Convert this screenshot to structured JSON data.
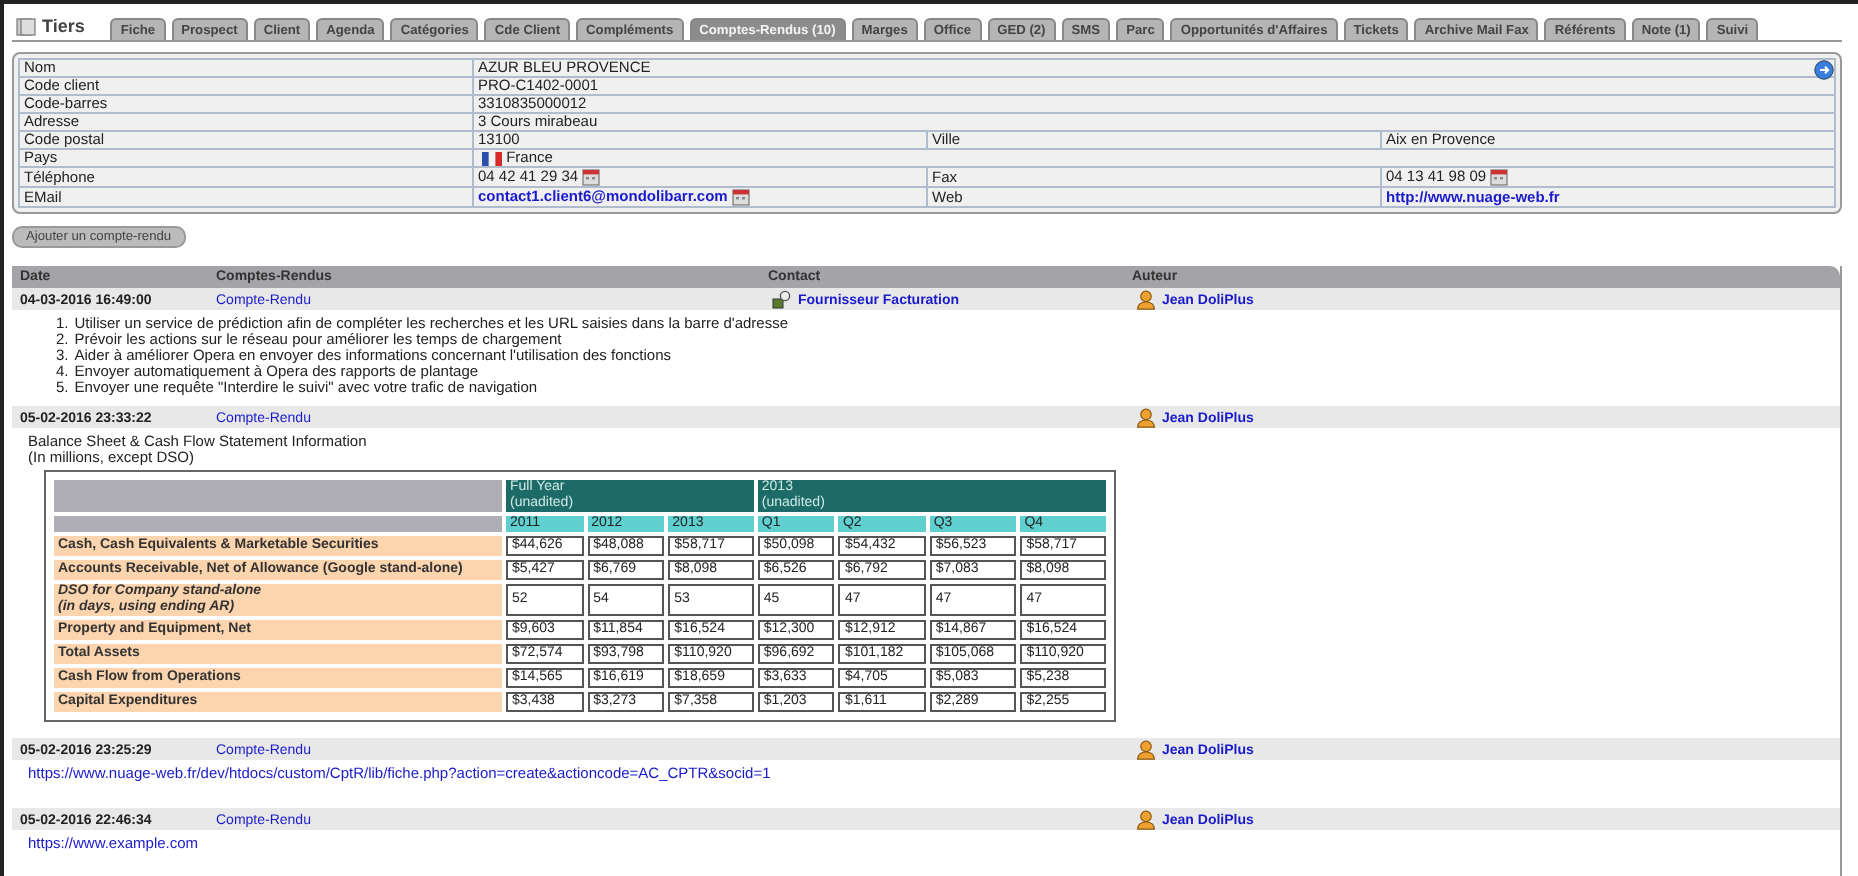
{
  "title": "Tiers",
  "tabs": [
    {
      "label": "Fiche",
      "selected": false
    },
    {
      "label": "Prospect",
      "selected": false
    },
    {
      "label": "Client",
      "selected": false
    },
    {
      "label": "Agenda",
      "selected": false
    },
    {
      "label": "Catégories",
      "selected": false
    },
    {
      "label": "Cde Client",
      "selected": false
    },
    {
      "label": "Compléments",
      "selected": false
    },
    {
      "label": "Comptes-Rendus (10)",
      "selected": true
    },
    {
      "label": "Marges",
      "selected": false
    },
    {
      "label": "Office",
      "selected": false
    },
    {
      "label": "GED (2)",
      "selected": false
    },
    {
      "label": "SMS",
      "selected": false
    },
    {
      "label": "Parc",
      "selected": false
    },
    {
      "label": "Opportunités d'Affaires",
      "selected": false
    },
    {
      "label": "Tickets",
      "selected": false
    },
    {
      "label": "Archive Mail Fax",
      "selected": false
    },
    {
      "label": "Référents",
      "selected": false
    },
    {
      "label": "Note (1)",
      "selected": false
    },
    {
      "label": "Suivi",
      "selected": false
    }
  ],
  "info": [
    {
      "cells": [
        {
          "text": "Nom"
        },
        {
          "text": "AZUR BLEU PROVENCE"
        }
      ]
    },
    {
      "cells": [
        {
          "text": "Code client"
        },
        {
          "text": "PRO-C1402-0001"
        }
      ]
    },
    {
      "cells": [
        {
          "text": "Code-barres"
        },
        {
          "text": "3310835000012"
        }
      ]
    },
    {
      "cells": [
        {
          "text": "Adresse"
        },
        {
          "text": "3 Cours mirabeau"
        }
      ]
    },
    {
      "cells": [
        {
          "text": "Code postal"
        },
        {
          "text": "13100"
        },
        {
          "text": "Ville"
        },
        {
          "text": "Aix en Provence"
        }
      ]
    },
    {
      "cells": [
        {
          "text": "Pays"
        },
        {
          "text": "France",
          "kind": "flag"
        }
      ]
    },
    {
      "cells": [
        {
          "text": "Téléphone"
        },
        {
          "text": "04 42 41 29 34",
          "kind": "calendar"
        },
        {
          "text": "Fax"
        },
        {
          "text": "04 13 41 98 09",
          "kind": "calendar"
        }
      ]
    },
    {
      "cells": [
        {
          "text": "EMail"
        },
        {
          "text": "contact1.client6@mondolibarr.com",
          "kind": "link_calendar"
        },
        {
          "text": "Web"
        },
        {
          "text": "http://www.nuage-web.fr",
          "kind": "link"
        }
      ]
    }
  ],
  "add_button": "Ajouter un compte-rendu",
  "columns": [
    "Date",
    "Comptes-Rendus",
    "Contact",
    "Auteur"
  ],
  "entries": [
    {
      "date": "04-03-2016 16:49:00",
      "title": "Compte-Rendu",
      "contact": "Fournisseur Facturation",
      "author": "Jean DoliPlus",
      "body": {
        "kind": "list",
        "items": [
          {
            "number": "1.",
            "text": "Utiliser un service de prédiction afin de compléter les recherches et les URL saisies dans la barre d'adresse"
          },
          {
            "number": "2.",
            "text": "Prévoir les actions sur le réseau pour améliorer les temps de chargement"
          },
          {
            "number": "3.",
            "text": "Aider à améliorer Opera en envoyer des informations concernant l'utilisation des fonctions"
          },
          {
            "number": "4.",
            "text": "Envoyer automatiquement à Opera des rapports de plantage"
          },
          {
            "number": "5.",
            "text": "Envoyer une requête \"Interdire le suivi\" avec votre trafic de navigation"
          }
        ]
      }
    },
    {
      "date": "05-02-2016 23:33:22",
      "title": "Compte-Rendu",
      "author": "Jean DoliPlus",
      "body": {
        "kind": "table",
        "caption": [
          "Balance Sheet & Cash Flow Statement Information",
          "(In millions, except DSO)"
        ],
        "groups": [
          {
            "lines": [
              "Full Year",
              "(unadited)"
            ]
          },
          {
            "lines": [
              "2013",
              "(unadited)"
            ]
          }
        ],
        "columns": [
          "2011",
          "2012",
          "2013",
          "Q1",
          "Q2",
          "Q3",
          "Q4"
        ],
        "rows": [
          {
            "lines": [
              "Cash, Cash Equivalents & Marketable Securities"
            ],
            "italic": false,
            "values": [
              "$44,626",
              "$48,088",
              "$58,717",
              "$50,098",
              "$54,432",
              "$56,523",
              "$58,717"
            ]
          },
          {
            "lines": [
              "Accounts Receivable, Net of Allowance (Google stand-alone)"
            ],
            "italic": false,
            "values": [
              "$5,427",
              "$6,769",
              "$8,098",
              "$6,526",
              "$6,792",
              "$7,083",
              "$8,098"
            ]
          },
          {
            "lines": [
              "DSO for Company stand-alone",
              "(in days, using ending AR)"
            ],
            "italic": true,
            "values": [
              "52",
              "54",
              "53",
              "45",
              "47",
              "47",
              "47"
            ]
          },
          {
            "lines": [
              "Property and Equipment, Net"
            ],
            "italic": false,
            "values": [
              "$9,603",
              "$11,854",
              "$16,524",
              "$12,300",
              "$12,912",
              "$14,867",
              "$16,524"
            ]
          },
          {
            "lines": [
              "Total Assets"
            ],
            "italic": false,
            "values": [
              "$72,574",
              "$93,798",
              "$110,920",
              "$96,692",
              "$101,182",
              "$105,068",
              "$110,920"
            ]
          },
          {
            "lines": [
              "Cash Flow from Operations"
            ],
            "italic": false,
            "values": [
              "$14,565",
              "$16,619",
              "$18,659",
              "$3,633",
              "$4,705",
              "$5,083",
              "$5,238"
            ]
          },
          {
            "lines": [
              "Capital Expenditures"
            ],
            "italic": false,
            "values": [
              "$3,438",
              "$3,273",
              "$7,358",
              "$1,203",
              "$1,611",
              "$2,289",
              "$2,255"
            ]
          }
        ]
      }
    },
    {
      "date": "05-02-2016 23:25:29",
      "title": "Compte-Rendu",
      "author": "Jean DoliPlus",
      "body": {
        "kind": "link",
        "text": "https://www.nuage-web.fr/dev/htdocs/custom/CptR/lib/fiche.php?action=create&actioncode=AC_CPTR&socid=1"
      }
    },
    {
      "date": "05-02-2016 22:46:34",
      "title": "Compte-Rendu",
      "author": "Jean DoliPlus",
      "body": {
        "kind": "link",
        "text": "https://www.example.com"
      }
    }
  ]
}
